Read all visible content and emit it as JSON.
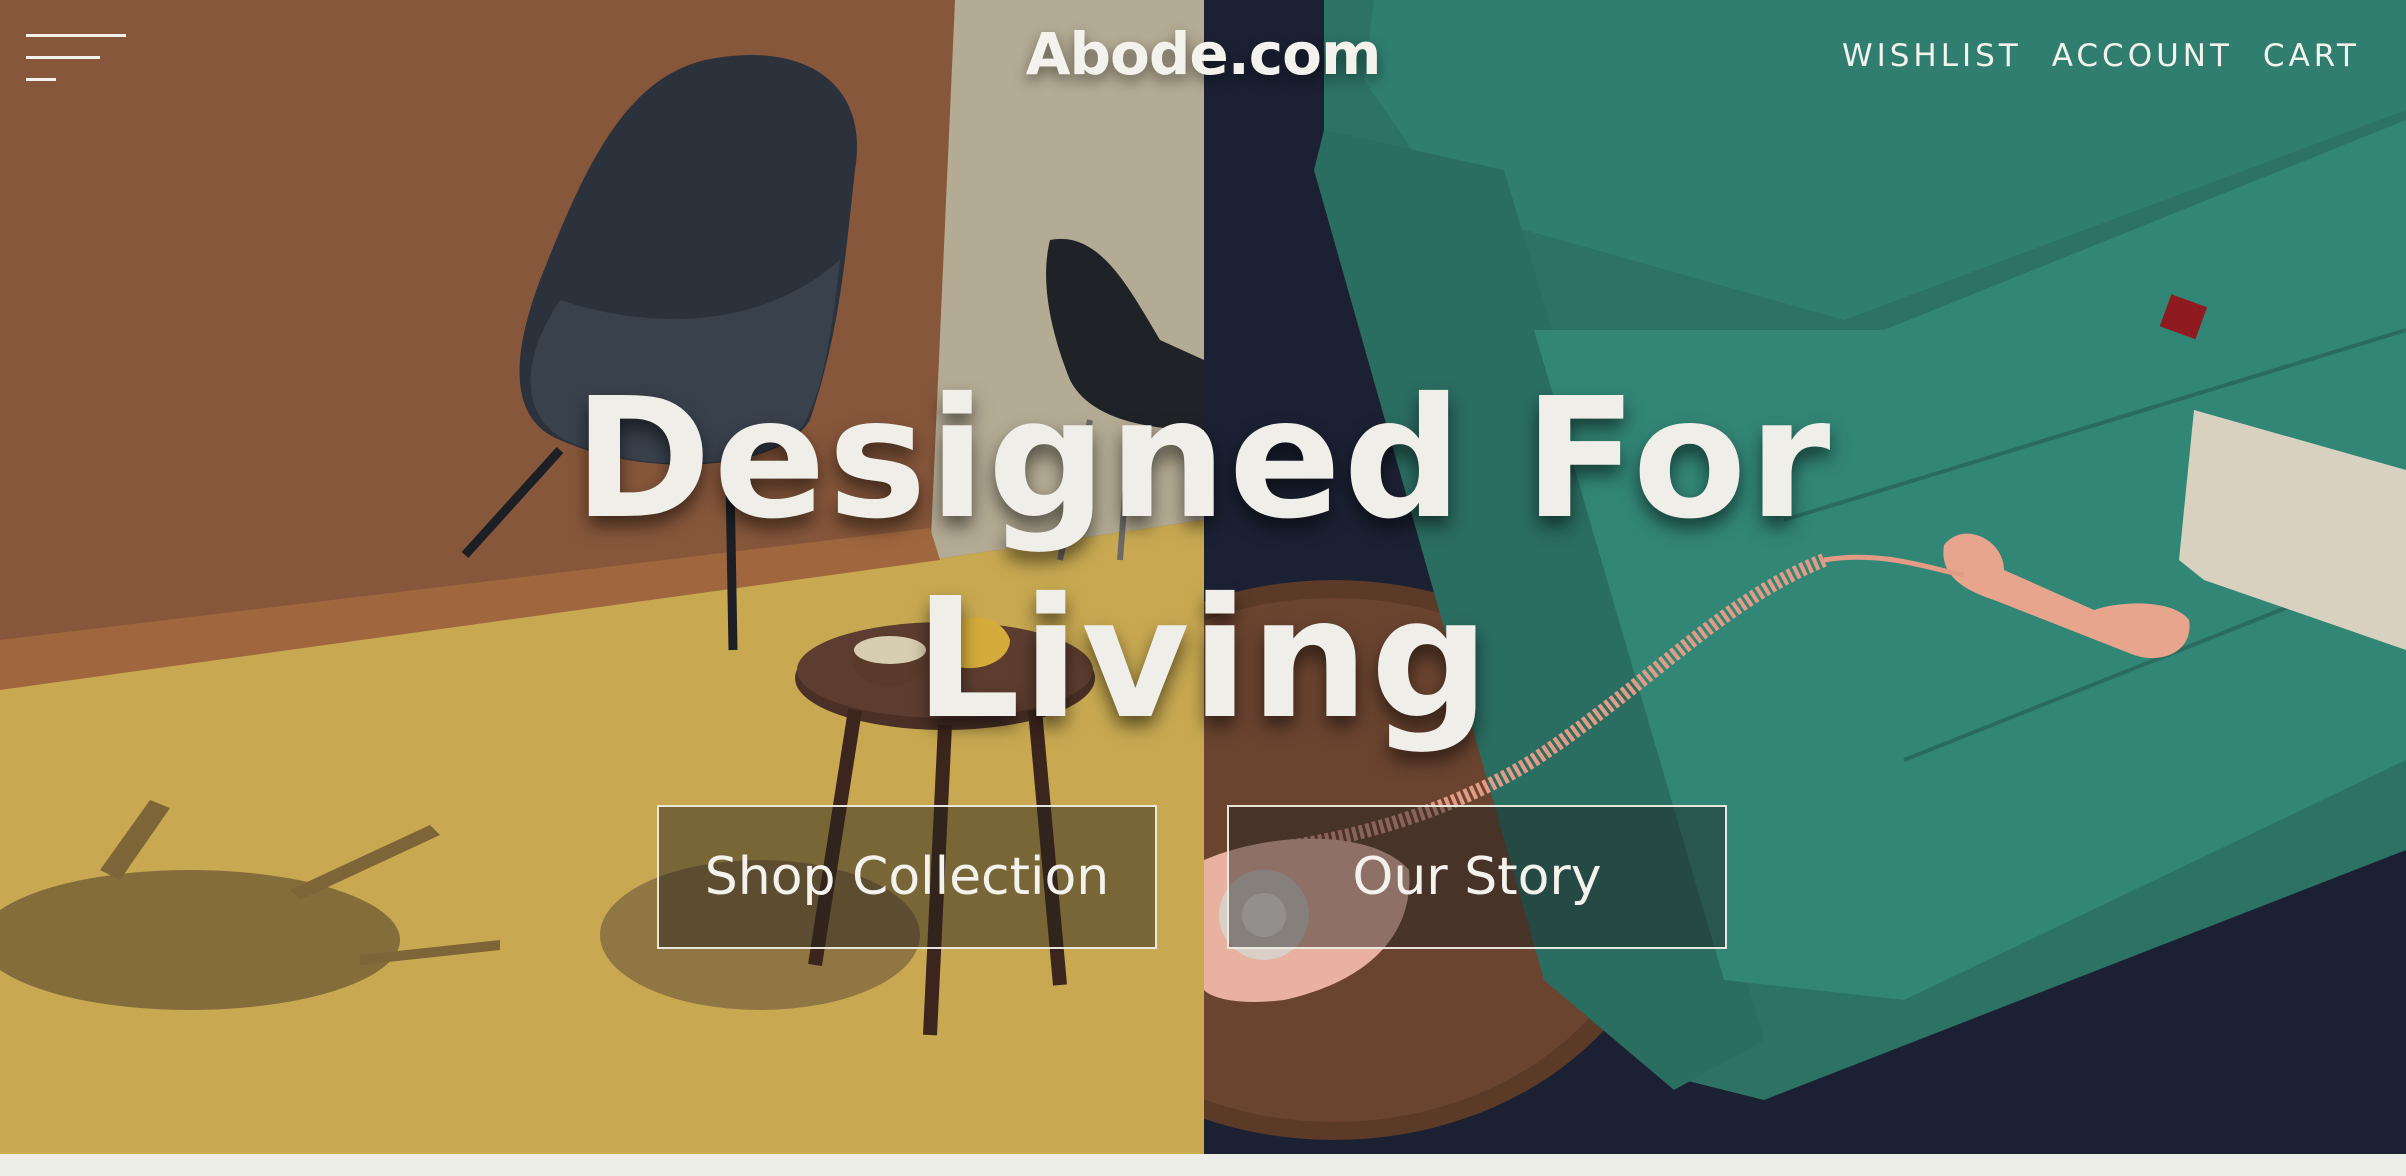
{
  "header": {
    "logo": "Abode.com",
    "nav": [
      {
        "label": "WISHLIST"
      },
      {
        "label": "ACCOUNT"
      },
      {
        "label": "CART"
      }
    ],
    "menu_icon": "hamburger-menu-icon"
  },
  "hero": {
    "headline_line1": "Designed For",
    "headline_line2": "Living",
    "buttons": {
      "shop_label": "Shop Collection",
      "story_label": "Our Story"
    }
  },
  "colors": {
    "text_light": "#f4f2ec",
    "left_wall": "#8b5a3e",
    "left_floor": "#c9aa53",
    "right_background": "#1b2133",
    "sofa_teal": "#2f7d70",
    "page_background": "#efefea"
  }
}
